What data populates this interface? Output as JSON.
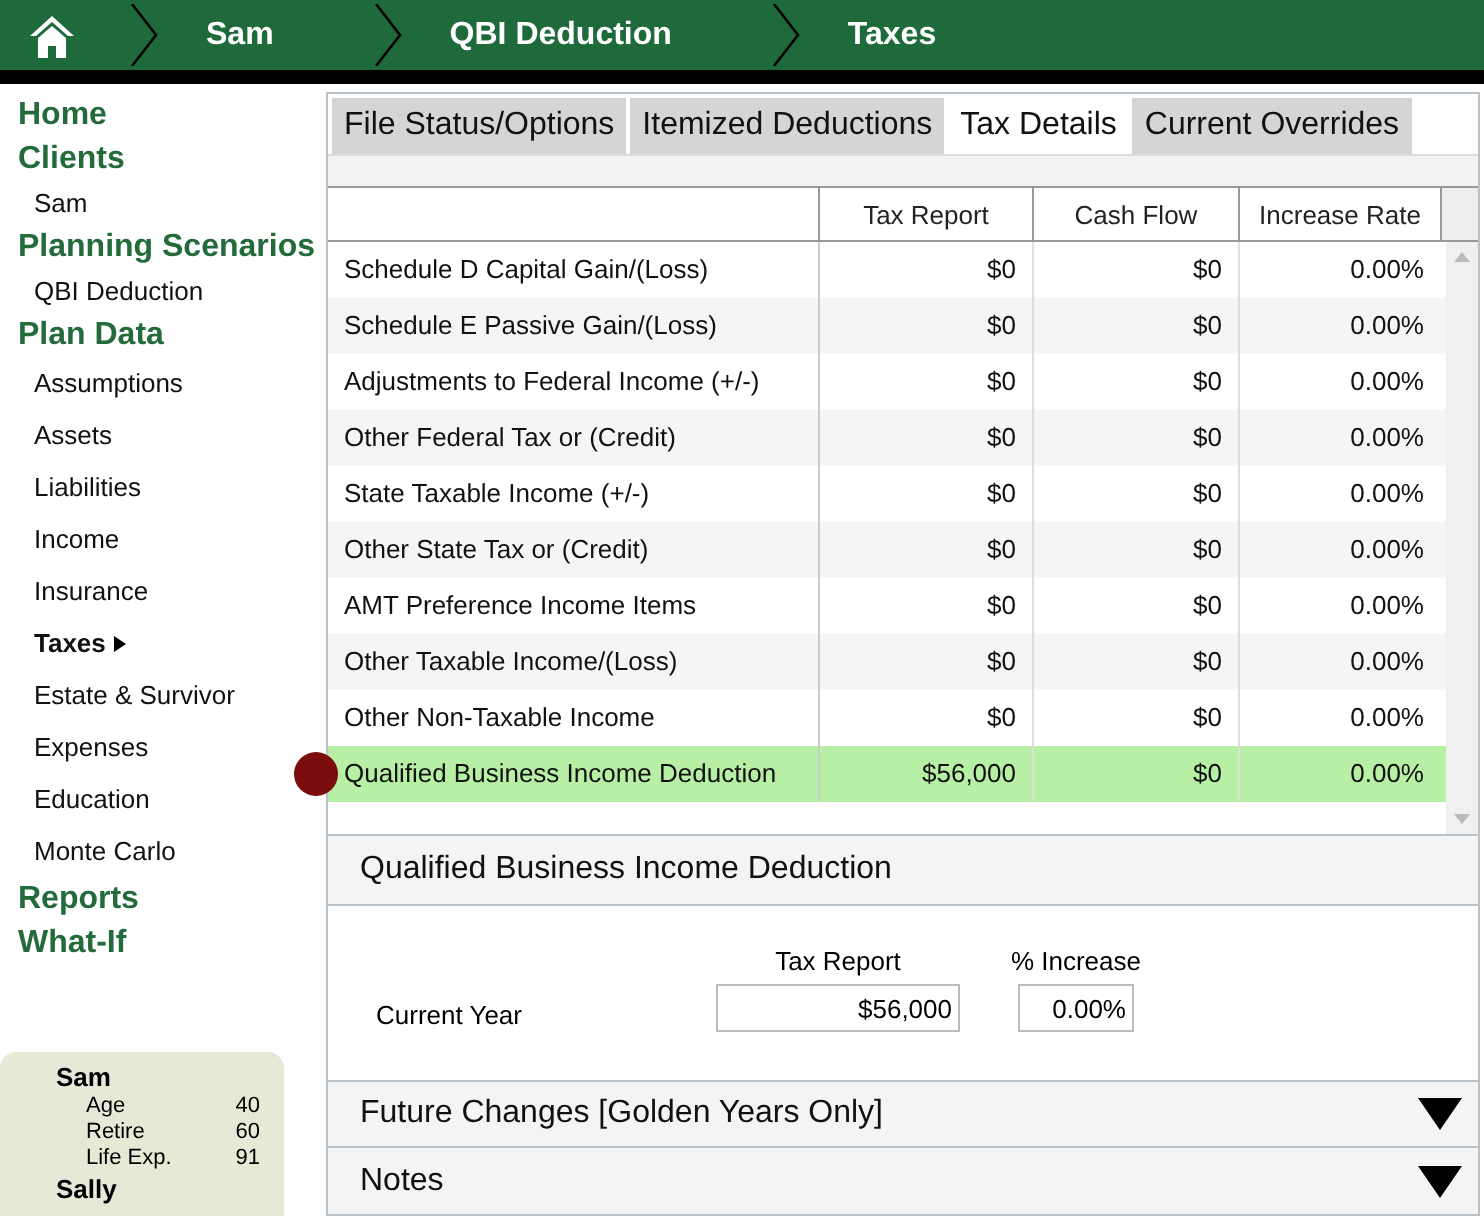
{
  "breadcrumb": [
    "Sam",
    "QBI Deduction",
    "Taxes"
  ],
  "nav": [
    {
      "kind": "heading",
      "label": "Home",
      "selected": false
    },
    {
      "kind": "heading",
      "label": "Clients",
      "selected": false
    },
    {
      "kind": "item",
      "label": "Sam",
      "selected": false
    },
    {
      "kind": "heading",
      "label": "Planning Scenarios",
      "selected": false
    },
    {
      "kind": "item",
      "label": "QBI Deduction",
      "selected": false
    },
    {
      "kind": "heading",
      "label": "Plan Data",
      "selected": false
    },
    {
      "kind": "item",
      "label": "Assumptions",
      "selected": false
    },
    {
      "kind": "item",
      "label": "Assets",
      "selected": false
    },
    {
      "kind": "item",
      "label": "Liabilities",
      "selected": false
    },
    {
      "kind": "item",
      "label": "Income",
      "selected": false
    },
    {
      "kind": "item",
      "label": "Insurance",
      "selected": false
    },
    {
      "kind": "item",
      "label": "Taxes",
      "selected": true
    },
    {
      "kind": "item",
      "label": "Estate & Survivor",
      "selected": false
    },
    {
      "kind": "item",
      "label": "Expenses",
      "selected": false
    },
    {
      "kind": "item",
      "label": "Education",
      "selected": false
    },
    {
      "kind": "item",
      "label": "Monte Carlo",
      "selected": false
    },
    {
      "kind": "heading",
      "label": "Reports",
      "selected": false
    },
    {
      "kind": "heading",
      "label": "What-If",
      "selected": false
    }
  ],
  "summary": [
    {
      "name": "Sam",
      "facts": [
        {
          "label": "Age",
          "value": "40"
        },
        {
          "label": "Retire",
          "value": "60"
        },
        {
          "label": "Life Exp.",
          "value": "91"
        }
      ]
    },
    {
      "name": "Sally"
    }
  ],
  "tabs": [
    {
      "label": "File Status/Options",
      "selected": false
    },
    {
      "label": "Itemized Deductions",
      "selected": false
    },
    {
      "label": "Tax Details",
      "selected": true
    },
    {
      "label": "Current Overrides",
      "selected": false
    }
  ],
  "table": {
    "columns": [
      "Tax Report",
      "Cash Flow",
      "Increase Rate"
    ],
    "rows": [
      {
        "label": "Schedule D Capital Gain/(Loss)",
        "cells": [
          "$0",
          "$0",
          "0.00%"
        ],
        "selected": false
      },
      {
        "label": "Schedule E Passive Gain/(Loss)",
        "cells": [
          "$0",
          "$0",
          "0.00%"
        ],
        "selected": false
      },
      {
        "label": "Adjustments to Federal Income (+/-)",
        "cells": [
          "$0",
          "$0",
          "0.00%"
        ],
        "selected": false
      },
      {
        "label": "Other Federal Tax or (Credit)",
        "cells": [
          "$0",
          "$0",
          "0.00%"
        ],
        "selected": false
      },
      {
        "label": "State Taxable Income (+/-)",
        "cells": [
          "$0",
          "$0",
          "0.00%"
        ],
        "selected": false
      },
      {
        "label": "Other State Tax or (Credit)",
        "cells": [
          "$0",
          "$0",
          "0.00%"
        ],
        "selected": false
      },
      {
        "label": "AMT Preference Income Items",
        "cells": [
          "$0",
          "$0",
          "0.00%"
        ],
        "selected": false
      },
      {
        "label": "Other Taxable Income/(Loss)",
        "cells": [
          "$0",
          "$0",
          "0.00%"
        ],
        "selected": false
      },
      {
        "label": "Other Non-Taxable Income",
        "cells": [
          "$0",
          "$0",
          "0.00%"
        ],
        "selected": false
      },
      {
        "label": "Qualified Business Income Deduction",
        "cells": [
          "$56,000",
          "$0",
          "0.00%"
        ],
        "selected": true
      }
    ]
  },
  "detail": {
    "title": "Qualified Business Income Deduction",
    "columns": [
      "Tax Report",
      "% Increase"
    ],
    "row_label": "Current Year",
    "values": [
      "$56,000",
      "0.00%"
    ]
  },
  "sections": [
    {
      "title": "Future Changes [Golden Years Only]",
      "expanded": false
    },
    {
      "title": "Notes",
      "expanded": false
    }
  ]
}
